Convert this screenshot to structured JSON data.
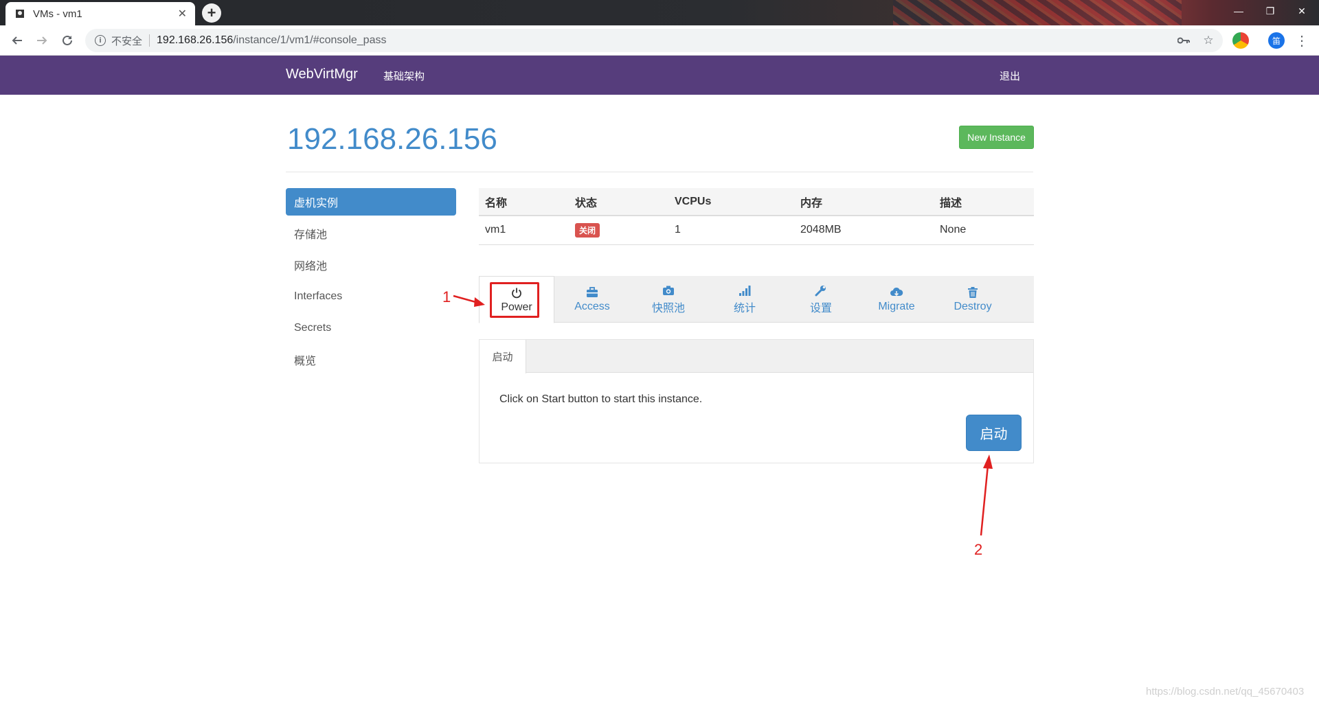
{
  "browser": {
    "tab_title": "VMs - vm1",
    "close_glyph": "✕",
    "new_tab_glyph": "+",
    "insecure_label": "不安全",
    "url_host": "192.168.26.156",
    "url_path": "/instance/1/vm1/#console_pass",
    "window_controls": [
      "—",
      "❐",
      "✕"
    ],
    "ext_badge": "笛"
  },
  "navbar": {
    "brand": "WebVirtMgr",
    "link_infra": "基础架构",
    "link_logout": "退出"
  },
  "page": {
    "host_title": "192.168.26.156",
    "new_instance_label": "New Instance"
  },
  "sidebar": {
    "items": [
      {
        "label": "虚机实例",
        "active": true
      },
      {
        "label": "存储池"
      },
      {
        "label": "网络池"
      },
      {
        "label": "Interfaces"
      },
      {
        "label": "Secrets"
      },
      {
        "label": "概览"
      }
    ]
  },
  "instance_table": {
    "headers": [
      "名称",
      "状态",
      "VCPUs",
      "内存",
      "描述"
    ],
    "row": {
      "name": "vm1",
      "status": "关闭",
      "vcpus": "1",
      "memory": "2048MB",
      "description": "None"
    }
  },
  "tabs": [
    {
      "label": "Power",
      "icon": "power-icon",
      "active": true
    },
    {
      "label": "Access",
      "icon": "briefcase-icon"
    },
    {
      "label": "快照池",
      "icon": "camera-icon"
    },
    {
      "label": "统计",
      "icon": "signal-icon"
    },
    {
      "label": "设置",
      "icon": "wrench-icon"
    },
    {
      "label": "Migrate",
      "icon": "cloud-download-icon"
    },
    {
      "label": "Destroy",
      "icon": "trash-icon"
    }
  ],
  "power_panel": {
    "subtab": "启动",
    "message": "Click on Start button to start this instance.",
    "start_button": "启动"
  },
  "annotations": {
    "marker_1": "1",
    "marker_2": "2",
    "color": "#e02020"
  },
  "watermark": "https://blog.csdn.net/qq_45670403",
  "colors": {
    "navbar": "#563d7c",
    "primary": "#428bca",
    "success": "#5cb85c",
    "danger": "#d9534f"
  }
}
